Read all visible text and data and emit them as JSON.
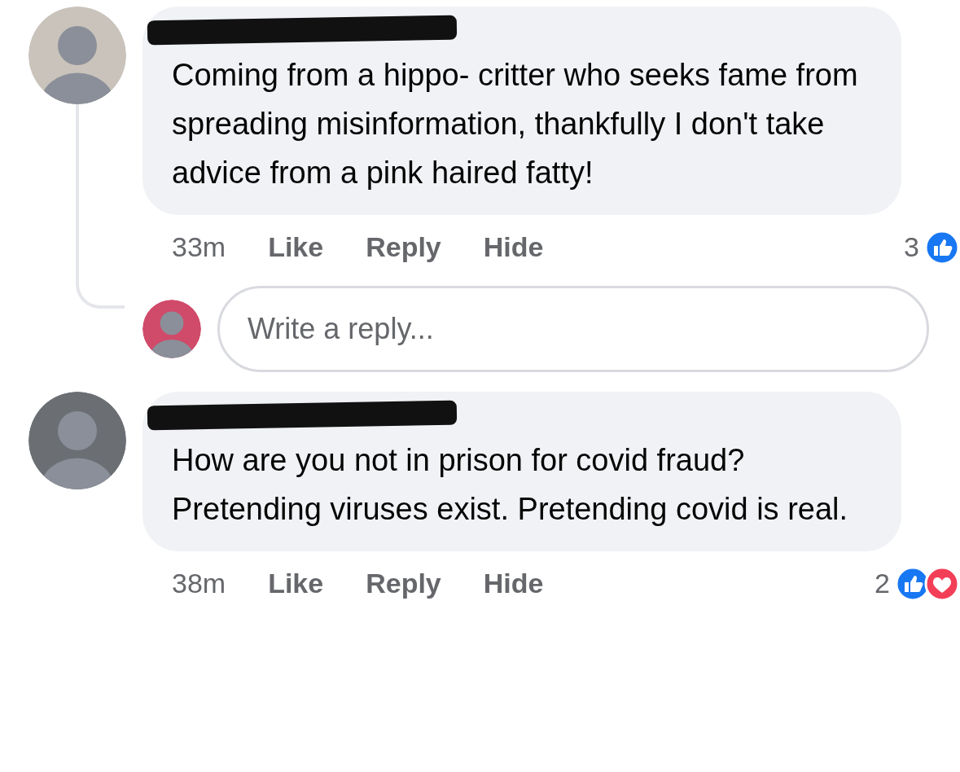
{
  "comments": [
    {
      "text": "Coming from a hippo- critter who seeks fame from spreading misinformation, thankfully I don't take advice from a pink haired fatty!",
      "time": "33m",
      "actions": [
        "Like",
        "Reply",
        "Hide"
      ],
      "reaction_count": "3",
      "reactions": [
        {
          "kind": "like"
        }
      ],
      "reply_box": {
        "placeholder": "Write a reply..."
      }
    },
    {
      "text": "How are you not in prison for covid fraud? Pretending viruses exist. Pretending covid is real.",
      "time": "38m",
      "actions": [
        "Like",
        "Reply",
        "Hide"
      ],
      "reaction_count": "2",
      "reactions": [
        {
          "kind": "like"
        },
        {
          "kind": "love"
        }
      ]
    }
  ]
}
